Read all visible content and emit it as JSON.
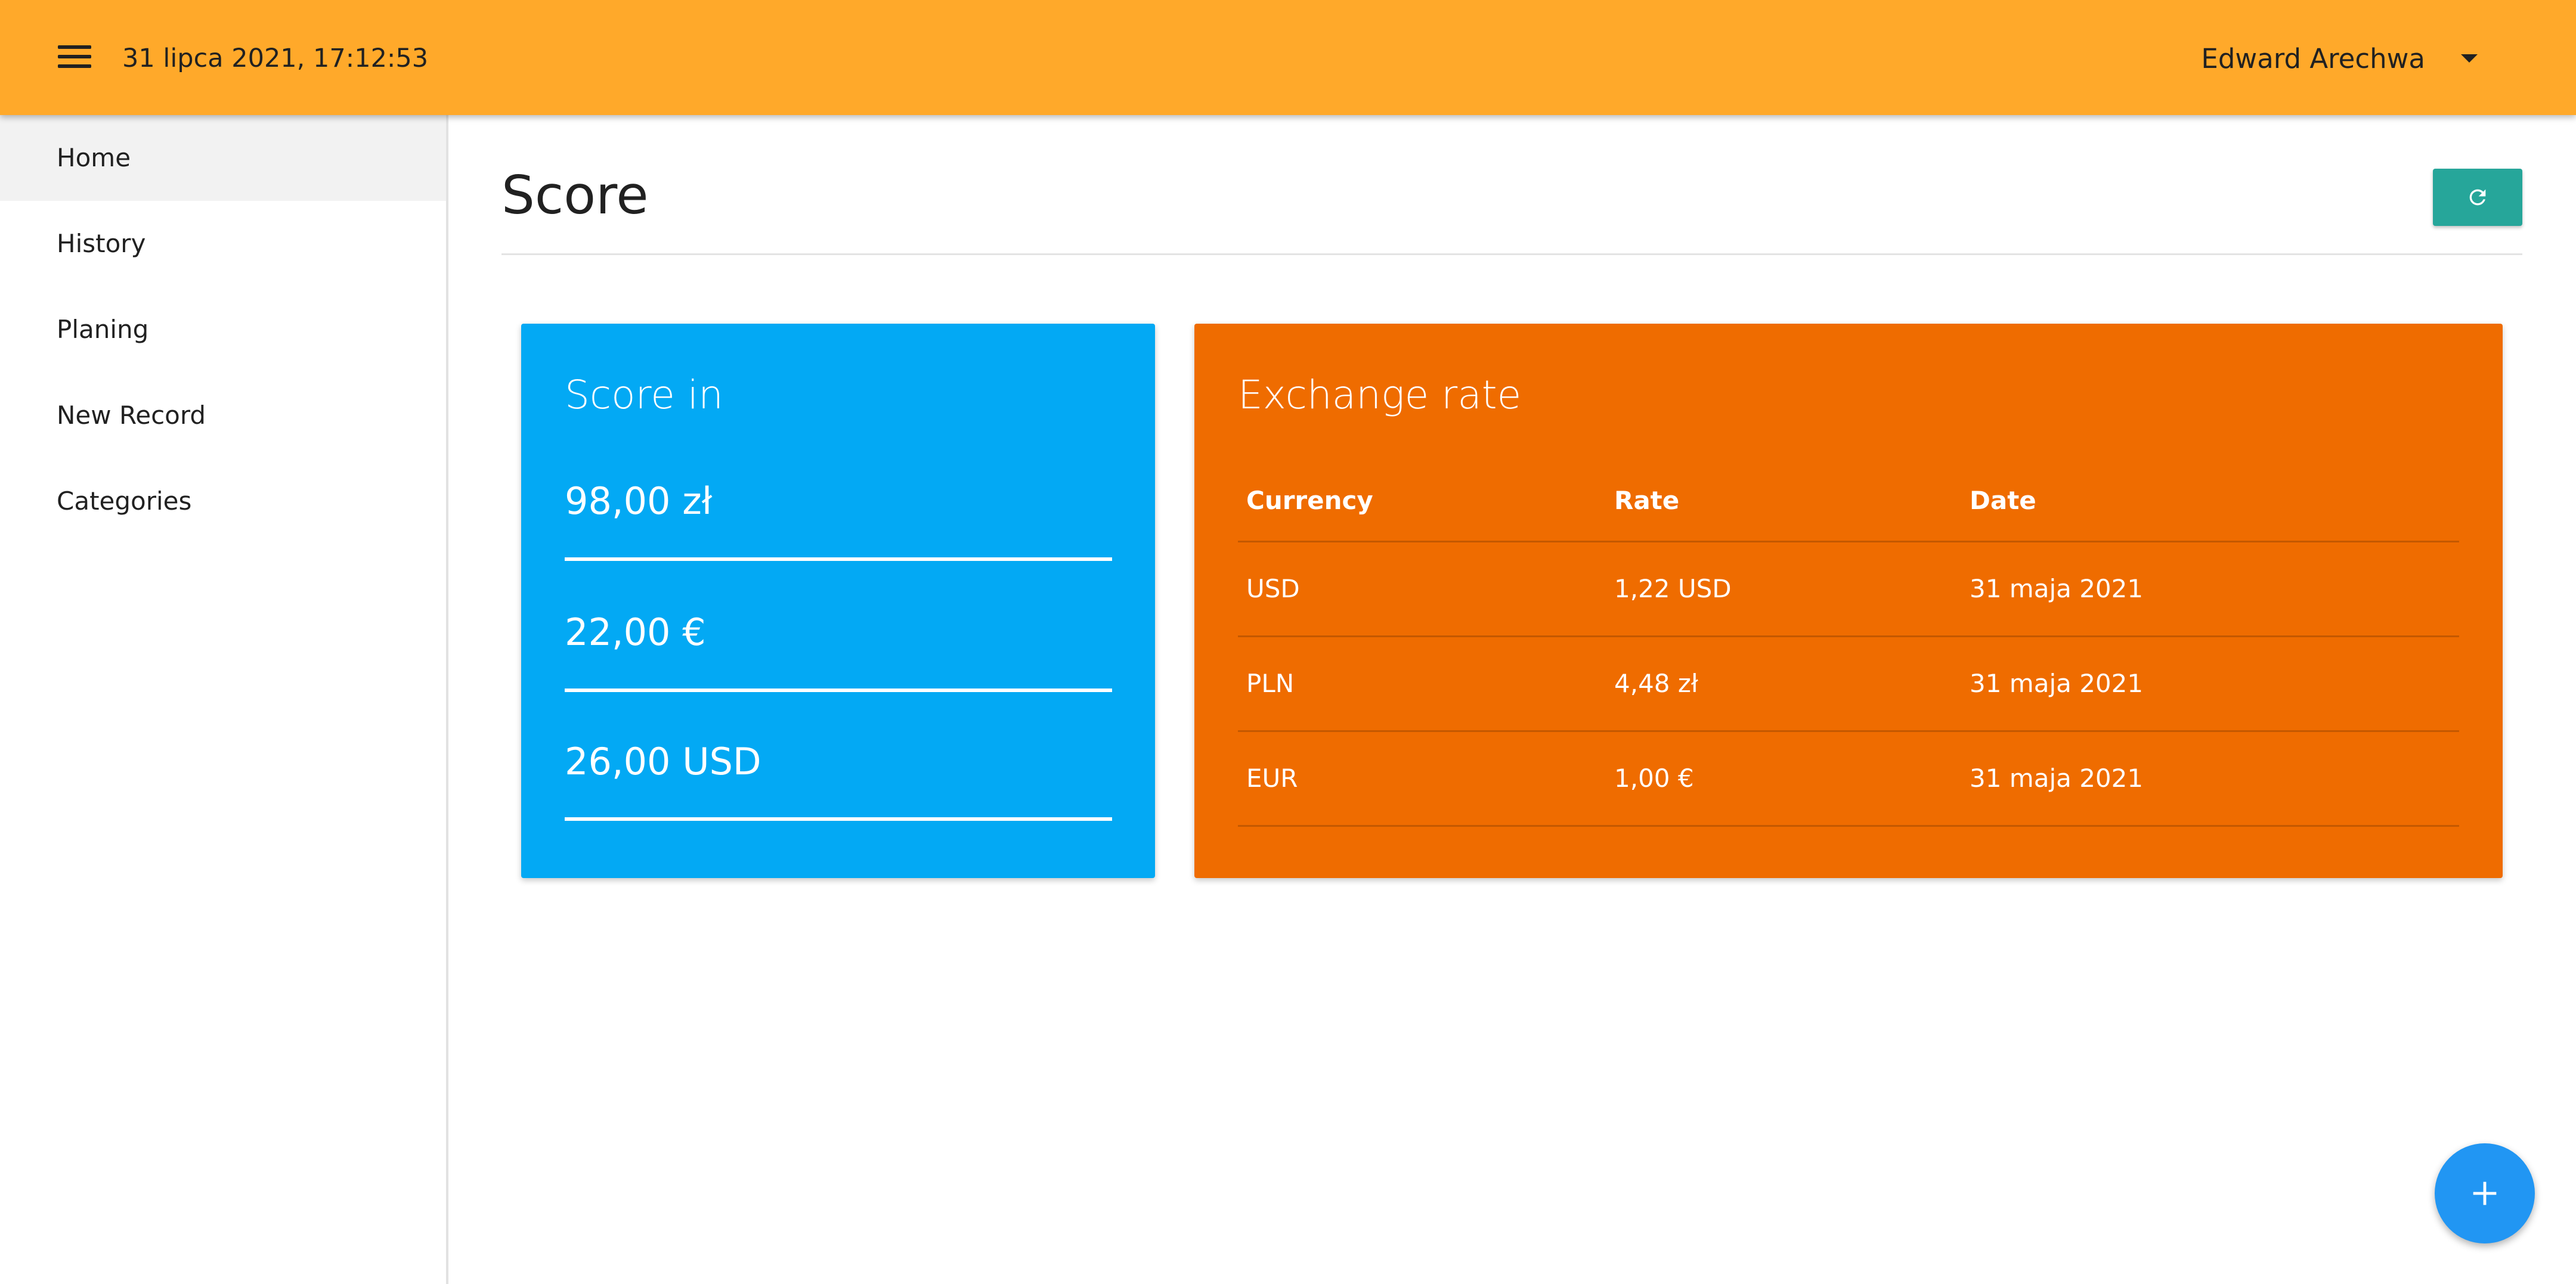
{
  "header": {
    "datetime": "31 lipca 2021, 17:12:53",
    "user_name": "Edward Arechwa",
    "background_color": "#ffa92a"
  },
  "sidebar": {
    "items": [
      {
        "label": "Home",
        "active": true
      },
      {
        "label": "History",
        "active": false
      },
      {
        "label": "Planing",
        "active": false
      },
      {
        "label": "New Record",
        "active": false
      },
      {
        "label": "Categories",
        "active": false
      }
    ]
  },
  "main": {
    "title": "Score",
    "refresh_icon": "refresh-icon",
    "refresh_color": "#26a69a"
  },
  "score_card": {
    "title": "Score in",
    "color": "#03a9f4",
    "values": [
      "98,00 zł",
      "22,00 €",
      "26,00 USD"
    ]
  },
  "rate_card": {
    "title": "Exchange rate",
    "color": "#ef6c00",
    "columns": [
      "Currency",
      "Rate",
      "Date"
    ],
    "rows": [
      {
        "currency": "USD",
        "rate": "1,22 USD",
        "date": "31 maja 2021"
      },
      {
        "currency": "PLN",
        "rate": "4,48 zł",
        "date": "31 maja 2021"
      },
      {
        "currency": "EUR",
        "rate": "1,00 €",
        "date": "31 maja 2021"
      }
    ]
  },
  "fab": {
    "icon": "plus-icon",
    "color": "#2196f3"
  }
}
